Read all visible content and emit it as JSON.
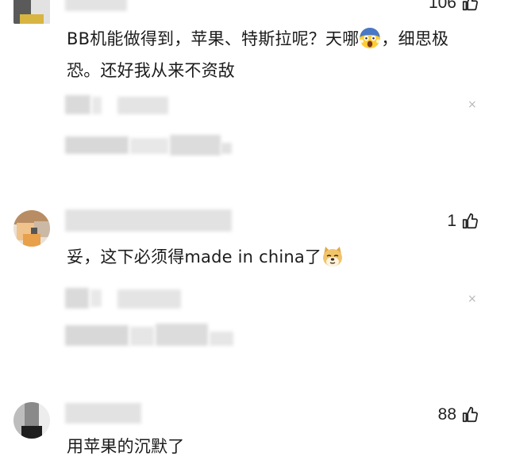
{
  "comments": [
    {
      "likes": "106",
      "text_lines": [
        "BB机能做得到，苹果、特斯拉呢？天哪",
        "，细思极",
        "恐。还好我从来不资敌"
      ]
    },
    {
      "likes": "1",
      "text_lines": [
        "妥，这下必须得made in china了"
      ]
    },
    {
      "likes": "88",
      "text_lines": [
        "用苹果的沉默了"
      ]
    }
  ],
  "icons": {
    "like": "thumbs-up-icon",
    "close": "close-icon",
    "emoji_scream": "face-screaming-emoji",
    "emoji_doge": "doge-emoji"
  },
  "close_glyph": "×",
  "colors": {
    "text": "#1c1c1c",
    "muted": "#b8b8b8",
    "blur_gray": "#d9d9d9"
  }
}
